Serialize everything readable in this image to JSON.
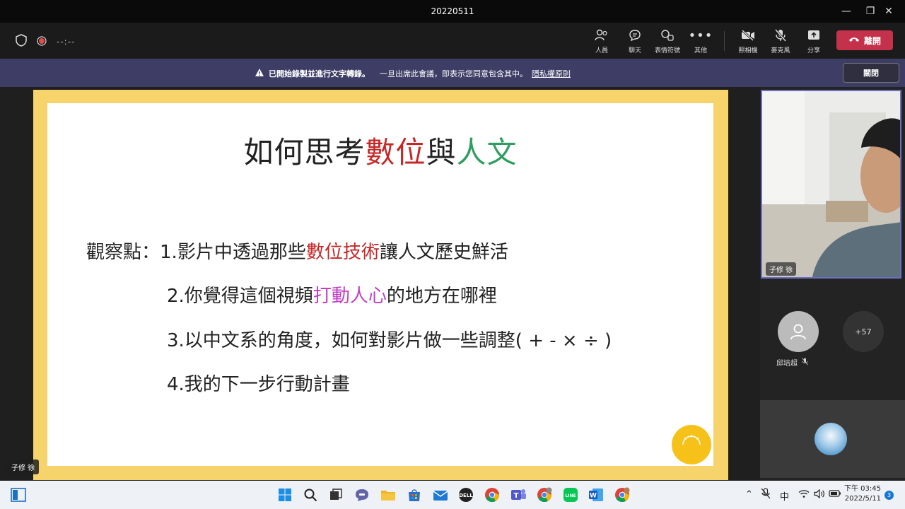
{
  "window": {
    "title": "20220511"
  },
  "toolbar": {
    "timer": "--:--",
    "buttons": [
      {
        "icon": "people-icon",
        "label": "人員"
      },
      {
        "icon": "chat-icon",
        "label": "聊天"
      },
      {
        "icon": "reactions-icon",
        "label": "表情符號"
      },
      {
        "icon": "more-icon",
        "label": "其他"
      },
      {
        "icon": "camera-off-icon",
        "label": "照相機"
      },
      {
        "icon": "mic-off-icon",
        "label": "麥克風"
      },
      {
        "icon": "share-icon",
        "label": "分享"
      }
    ],
    "leave_label": "離開",
    "leave_color": "#c4314b"
  },
  "banner": {
    "bold_text": "已開始錄製並進行文字轉錄。",
    "text": "一旦出席此會議，即表示您同意包含其中。",
    "link": "隱私權原則",
    "close_label": "關閉"
  },
  "slide": {
    "title_plain1": "如何思考",
    "title_red": "數位",
    "title_plain2": "與",
    "title_green": "人文",
    "intro": "觀察點：",
    "points": [
      {
        "a": "1.影片中透過那些",
        "b": "數位技術",
        "c": "讓人文歷史鮮活"
      },
      {
        "a": "2.你覺得這個視頻",
        "b": "打動人心",
        "c": "的地方在哪裡"
      },
      {
        "a": "3.以中文系的角度，如何對影片做一些調整( + - × ÷ )",
        "b": "",
        "c": ""
      },
      {
        "a": "4.我的下一步行動計畫",
        "b": "",
        "c": ""
      }
    ],
    "frame_color": "#f6d36b"
  },
  "participants": {
    "presenter_name": "子修 徐",
    "video_label": "子修 徐",
    "attendee_name": "邱培超",
    "more_count": "+57"
  },
  "taskbar": {
    "ime": "中",
    "time": "下午 03:45",
    "date": "2022/5/11",
    "notifications": "3"
  }
}
